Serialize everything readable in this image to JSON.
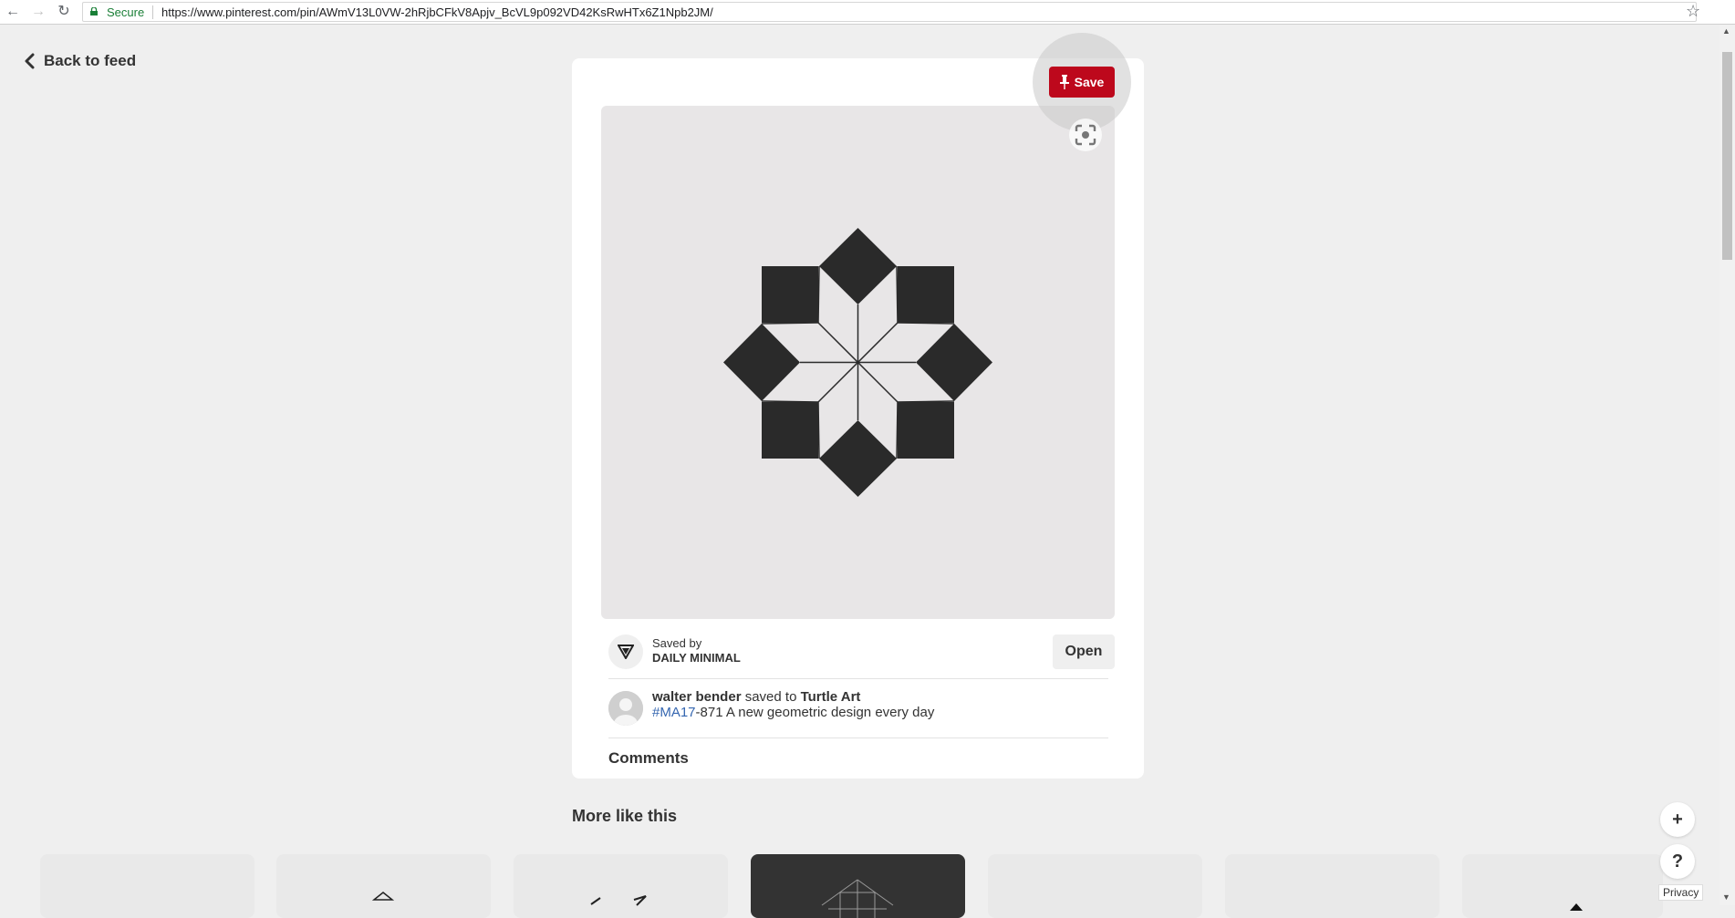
{
  "browser": {
    "secure_label": "Secure",
    "url": "https://www.pinterest.com/pin/AWmV13L0VW-2hRjbCFkV8Apjv_BcVL9p092VD42KsRwHTx6Z1Npb2JM/"
  },
  "nav": {
    "back_label": "Back to feed"
  },
  "pin": {
    "save_label": "Save",
    "saved_by_label": "Saved by",
    "saved_by_name": "DAILY MINIMAL",
    "open_label": "Open",
    "pinner_name": "walter bender",
    "saved_to_text": "saved to",
    "board_name": "Turtle Art",
    "hashtag": "#MA17",
    "description": "-871 A new geometric design every day",
    "comments_label": "Comments"
  },
  "more": {
    "heading": "More like this"
  },
  "floating": {
    "add_label": "+",
    "help_label": "?",
    "privacy_label": "Privacy"
  },
  "colors": {
    "save_red": "#bd081c",
    "background": "#efefef",
    "hashtag_blue": "#3566b0"
  }
}
